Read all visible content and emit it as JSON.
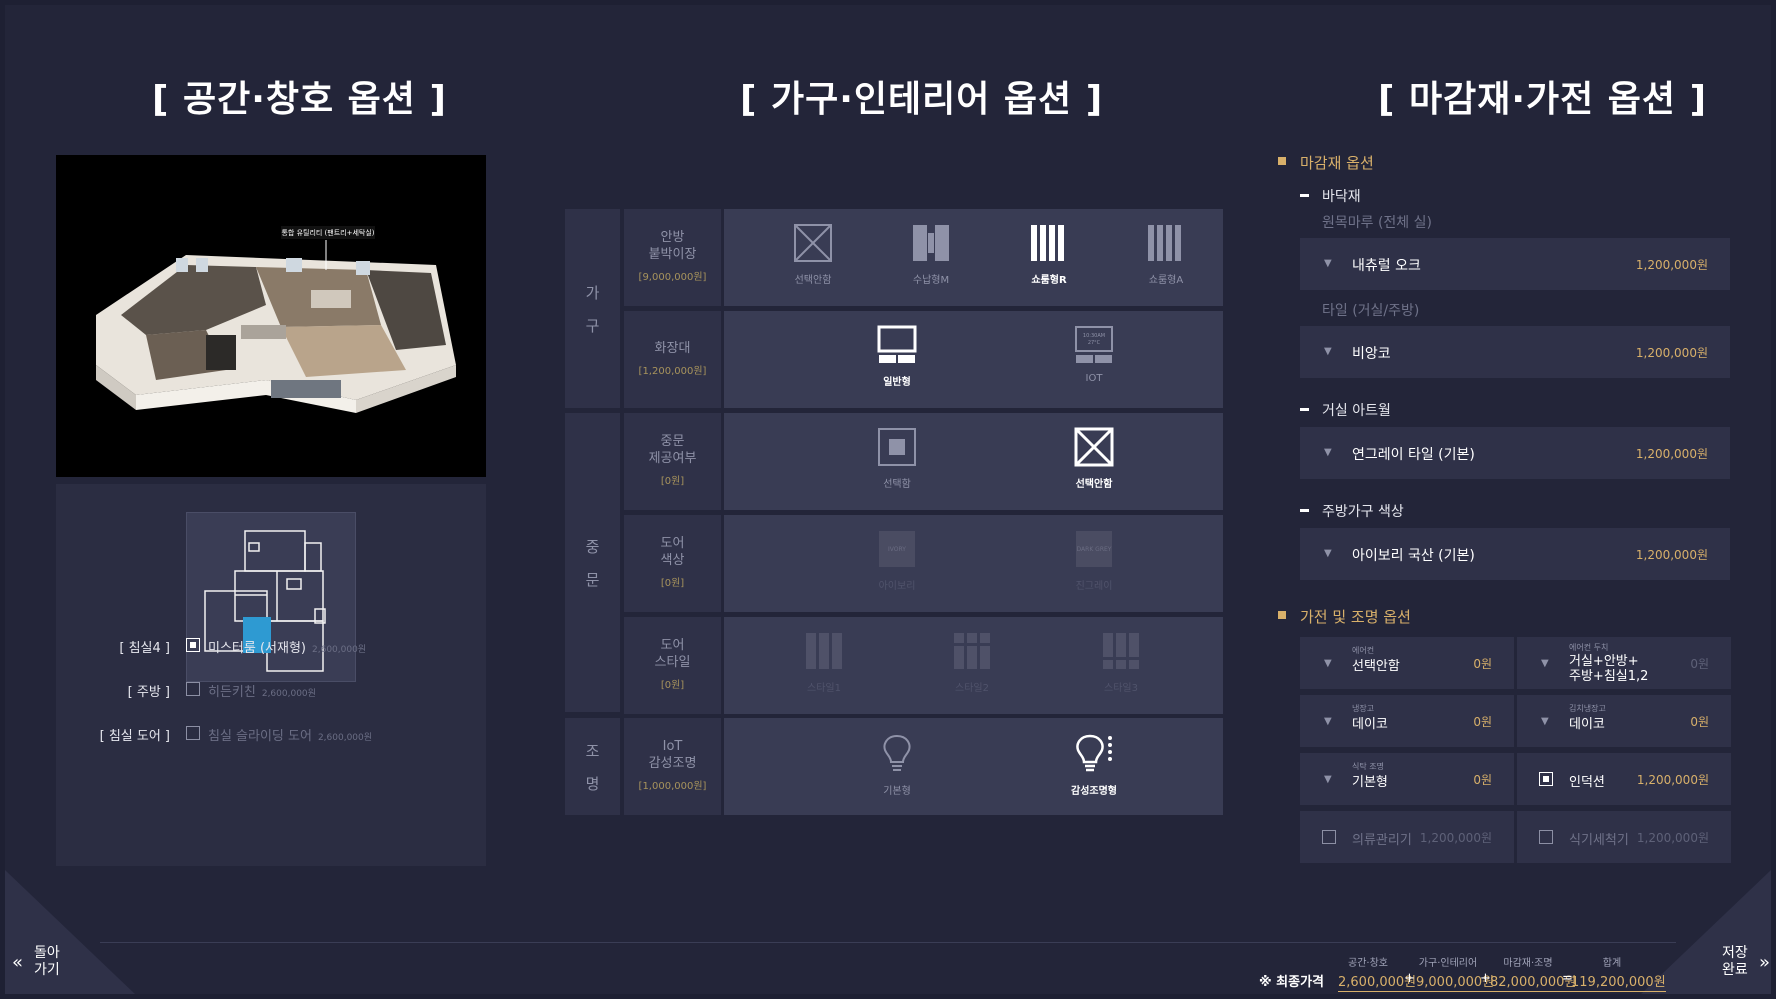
{
  "sections": {
    "left_title": "[ 공간·창호 옵션 ]",
    "center_title": "[ 가구·인테리어 옵션 ]",
    "right_title": "[ 마감재·가전 옵션 ]"
  },
  "render": {
    "label": "통합 유틸리티 (팬트리+세탁실)"
  },
  "space_options": [
    {
      "label": "[ 침실4 ]",
      "name": "미스터룸 (서재형)",
      "price": "2,600,000원",
      "checked": true
    },
    {
      "label": "[ 주방 ]",
      "name": "히든키친",
      "price": "2,600,000원",
      "checked": false
    },
    {
      "label": "[ 침실 도어 ]",
      "name": "침실 슬라이딩 도어",
      "price": "2,600,000원",
      "checked": false
    }
  ],
  "furniture": {
    "cat_gagu": [
      "가",
      "구"
    ],
    "cat_jungmun": [
      "중",
      "문"
    ],
    "cat_jomyeong": [
      "조",
      "명"
    ],
    "rows": [
      {
        "title": [
          "안방",
          "붙박이장"
        ],
        "price": "[9,000,000원]",
        "choices": [
          "선택안함",
          "수납형M",
          "쇼룸형R",
          "쇼룸형A"
        ]
      },
      {
        "title": [
          "화장대"
        ],
        "price": "[1,200,000원]",
        "choices": [
          "일반형",
          "IOT"
        ]
      },
      {
        "title": [
          "중문",
          "제공여부"
        ],
        "price": "[0원]",
        "choices": [
          "선택함",
          "선택안함"
        ]
      },
      {
        "title": [
          "도어",
          "색상"
        ],
        "price": "[0원]",
        "choices": [
          "아이보리",
          "진그레이"
        ],
        "swatches": [
          "IVORY",
          "DARK GREY"
        ]
      },
      {
        "title": [
          "도어",
          "스타일"
        ],
        "price": "[0원]",
        "choices": [
          "스타일1",
          "스타일2",
          "스타일3"
        ]
      },
      {
        "title": [
          "IoT",
          "감성조명"
        ],
        "price": "[1,000,000원]",
        "choices": [
          "기본형",
          "감성조명형"
        ]
      }
    ],
    "iot_screen": [
      "10:30AM",
      "27°C"
    ]
  },
  "finish": {
    "head1": "마감재 옵션",
    "floor_sub": "바닥재",
    "floor_note1": "원목마루 (전체 실)",
    "floor_sel1": {
      "name": "내츄럴 오크",
      "price": "1,200,000원"
    },
    "floor_note2": "타일 (거실/주방)",
    "floor_sel2": {
      "name": "비앙코",
      "price": "1,200,000원"
    },
    "artwall_sub": "거실 아트월",
    "artwall_sel": {
      "name": "연그레이 타일 (기본)",
      "price": "1,200,000원"
    },
    "kitchen_sub": "주방가구 색상",
    "kitchen_sel": {
      "name": "아이보리 국산 (기본)",
      "price": "1,200,000원"
    },
    "head2": "가전 및 조명 옵션",
    "cells": [
      {
        "cap": "에어컨",
        "val": "선택안함",
        "price": "0원"
      },
      {
        "cap": "에어컨 두치",
        "val1": "거실+안방+",
        "val2": "주방+침실1,2",
        "price": "0원"
      },
      {
        "cap": "냉장고",
        "val": "데이코",
        "price": "0원"
      },
      {
        "cap": "김치냉장고",
        "val": "데이코",
        "price": "0원"
      },
      {
        "cap": "식탁 조명",
        "val": "기본형",
        "price": "0원"
      },
      {
        "val": "인덕션",
        "price": "1,200,000원",
        "checked": true
      },
      {
        "val": "의류관리기",
        "price": "1,200,000원",
        "checked": false
      },
      {
        "val": "식기세척기",
        "price": "1,200,000원",
        "checked": false
      }
    ]
  },
  "footer": {
    "back1": "돌아",
    "back2": "가기",
    "save1": "저장",
    "save2": "완료",
    "final_label": "※ 최종가격",
    "captions": [
      "공간·창호",
      "가구·인테리어",
      "마감재·조명",
      "합계"
    ],
    "values": [
      "2,600,000원",
      "9,000,000원",
      "82,000,000원",
      "119,200,000원"
    ],
    "ops": [
      "+",
      "+",
      "="
    ]
  },
  "colors": {
    "accent": "#d8b06a",
    "background": "#232539",
    "panel": "#2f3148"
  }
}
